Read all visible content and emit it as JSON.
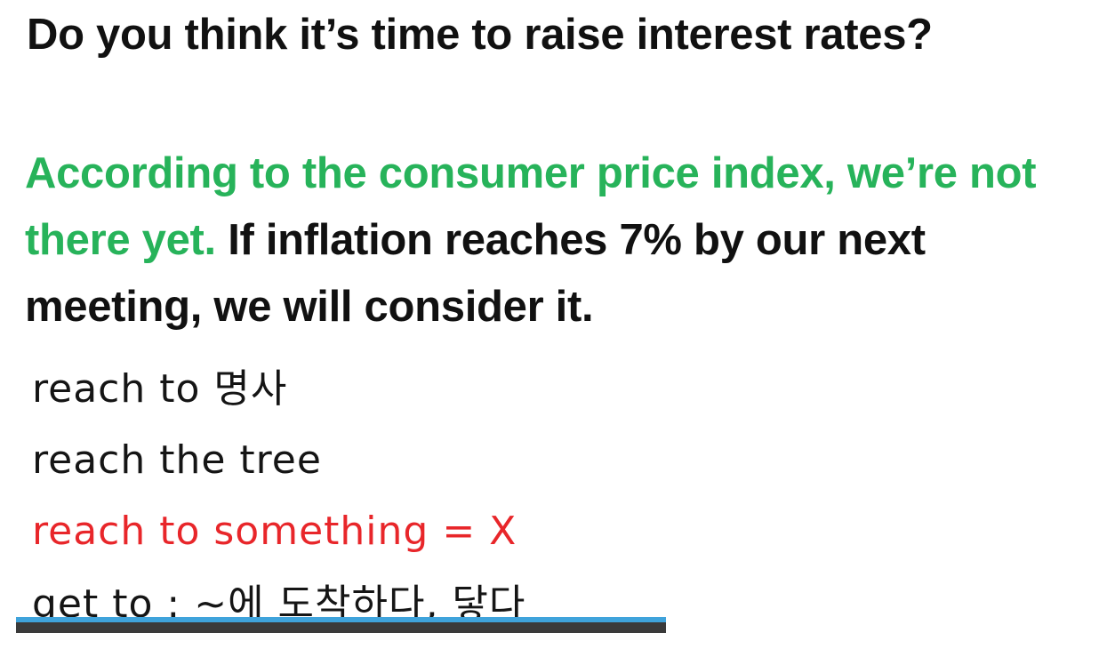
{
  "slide": {
    "question": "Do you think it’s time to raise interest rates?",
    "answer": {
      "green_part": "According to the consumer price index, we’re not there yet.",
      "black_part": " If inflation reaches 7% by our next meeting, we will consider it."
    },
    "notes": [
      {
        "text": "reach to 명사",
        "color": "#151515"
      },
      {
        "text": "reach the tree",
        "color": "#151515"
      },
      {
        "text": "reach to something = X",
        "color": "#e8262a"
      },
      {
        "text": "get to : ~에 도착하다, 닿다",
        "color": "#151515"
      }
    ]
  },
  "player": {
    "progress_percent": 100,
    "progress_color": "#3fa3db",
    "track_color": "#3a3a3a"
  },
  "colors": {
    "green": "#27b35a",
    "black": "#111111",
    "red": "#e8262a"
  }
}
